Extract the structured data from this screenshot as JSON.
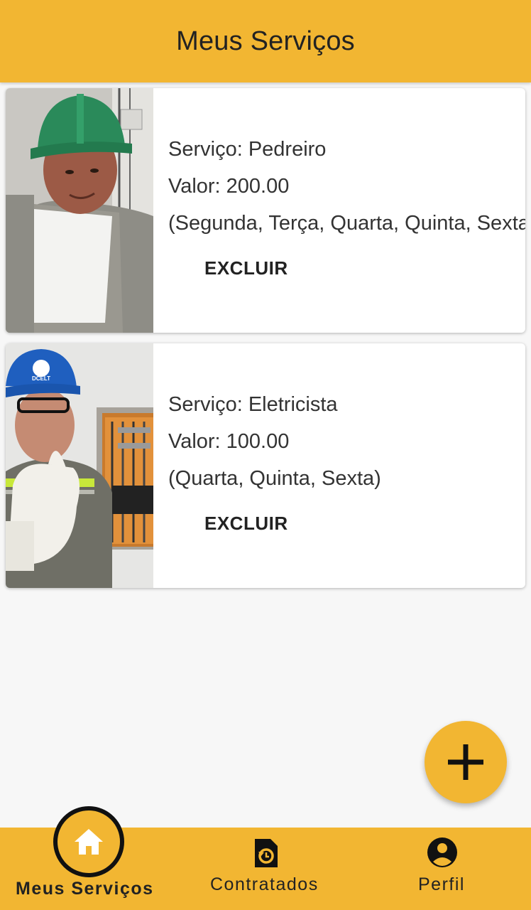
{
  "appbar": {
    "title": "Meus Serviços"
  },
  "services": [
    {
      "service_line": "Serviço: Pedreiro",
      "value_line": "Valor: 200.00",
      "days_line": "(Segunda, Terça, Quarta, Quinta, Sexta)",
      "delete_label": "EXCLUIR",
      "photo": "construction-worker-green-helmet"
    },
    {
      "service_line": "Serviço: Eletricista",
      "value_line": "Valor: 100.00",
      "days_line": "(Quarta, Quinta, Sexta)",
      "delete_label": "EXCLUIR",
      "photo": "electrician-blue-helmet-thumbs-up",
      "helmet_text": "DCELT"
    }
  ],
  "fab": {
    "icon": "plus-icon"
  },
  "bottom_nav": {
    "items": [
      {
        "label": "Meus Serviços",
        "icon": "home-icon",
        "active": true
      },
      {
        "label": "Contratados",
        "icon": "document-history-icon",
        "active": false
      },
      {
        "label": "Perfil",
        "icon": "account-circle-icon",
        "active": false
      }
    ]
  },
  "colors": {
    "primary": "#f2b632",
    "text": "#222222",
    "background": "#f7f7f7"
  }
}
